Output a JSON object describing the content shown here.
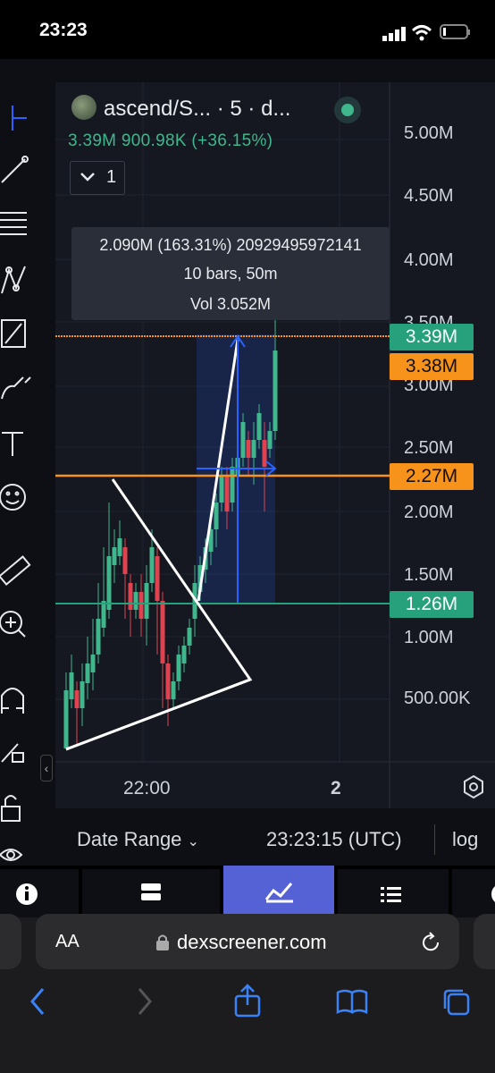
{
  "status_bar": {
    "time": "23:23"
  },
  "header": {
    "title": "ascend/S... · 5 · d...",
    "price": "3.39M",
    "volume": "900.98K",
    "change": "(+36.15%)",
    "interval_count": "1"
  },
  "tooltip": {
    "line1": "2.090M (163.31%) 20929495972141",
    "line2": "10 bars, 50m",
    "line3": "Vol 3.052M"
  },
  "y_axis": [
    "5.00M",
    "4.50M",
    "4.00M",
    "3.50M",
    "3.00M",
    "2.50M",
    "2.00M",
    "1.50M",
    "1.00M",
    "500.00K"
  ],
  "price_tags": {
    "current": "3.39M",
    "upper_line": "3.38M",
    "lower_line": "2.27M",
    "support": "1.26M"
  },
  "x_axis": {
    "label1": "22:00",
    "label2": "2"
  },
  "bottom": {
    "date_range": "Date Range",
    "time": "23:23:15 (UTC)",
    "log": "log"
  },
  "browser": {
    "aa": "AA",
    "url": "dexscreener.com"
  },
  "colors": {
    "up": "#3fb68b",
    "down": "#e0434f",
    "orange": "#f7931a",
    "support": "#26a17b",
    "measure": "#2962ff"
  },
  "chart_data": {
    "type": "candlestick",
    "log_scale": true,
    "y_ticks": [
      "500.00K",
      "1.00M",
      "1.50M",
      "2.00M",
      "2.50M",
      "3.00M",
      "3.50M",
      "4.00M",
      "4.50M",
      "5.00M"
    ],
    "x_ticks": [
      "22:00",
      "2"
    ],
    "horizontal_lines": [
      3.38,
      2.27,
      1.26
    ],
    "last_price": 3.39
  }
}
